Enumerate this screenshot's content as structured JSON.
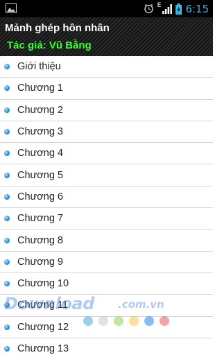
{
  "status_bar": {
    "time": "6:15",
    "network_letter": "E",
    "icons": [
      "image-icon",
      "alarm-clock-icon",
      "signal-icon",
      "battery-icon"
    ]
  },
  "header": {
    "title": "Mảnh ghép hôn nhân",
    "author": "Tác giả: Vũ Bằng"
  },
  "chapters": [
    "Giới thiệu",
    "Chương 1",
    "Chương 2",
    "Chương 3",
    "Chương 4",
    "Chương 5",
    "Chương 6",
    "Chương 7",
    "Chương 8",
    "Chương 9",
    "Chương 10",
    "Chương 11",
    "Chương 12",
    "Chương 13"
  ],
  "watermark": {
    "brand": "Download",
    "domain": ".com.vn",
    "dot_colors": [
      "#4aa8e0",
      "#c8c8c8",
      "#8fd14f",
      "#f2c94c",
      "#2f80ed",
      "#eb5757"
    ]
  },
  "colors": {
    "accent_time": "#33b5e5",
    "author_green": "#33ff33",
    "bullet_blue": "#3aa0e8"
  }
}
